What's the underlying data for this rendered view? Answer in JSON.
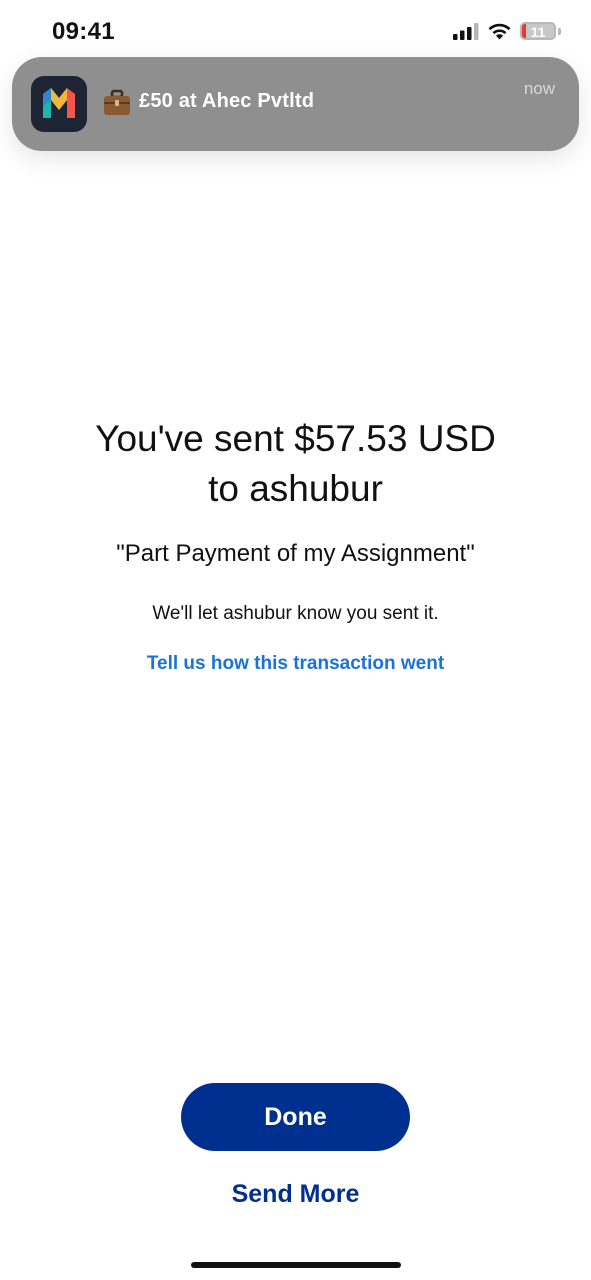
{
  "status_bar": {
    "time": "09:41",
    "battery_level": "11",
    "battery_fraction": 0.11,
    "signal_icon": "cellular-signal-icon",
    "wifi_icon": "wifi-icon",
    "battery_icon": "battery-icon"
  },
  "notification": {
    "app_icon": "monzo-app-icon",
    "emoji": "briefcase-emoji",
    "text": "£50 at Ahec Pvtltd",
    "time": "now"
  },
  "confirmation": {
    "headline_line1": "You've sent $57.53 USD",
    "headline_line2": "to ashubur",
    "note": "\"Part Payment of my Assignment\"",
    "subtext": "We'll let ashubur know you sent it.",
    "feedback_link": "Tell us how this transaction went"
  },
  "actions": {
    "done_label": "Done",
    "send_more_label": "Send More"
  },
  "colors": {
    "primary_button": "#00308f",
    "link": "#1a73d8",
    "battery_low": "#e43c2f",
    "notification_bg": "#8f8f8f"
  }
}
